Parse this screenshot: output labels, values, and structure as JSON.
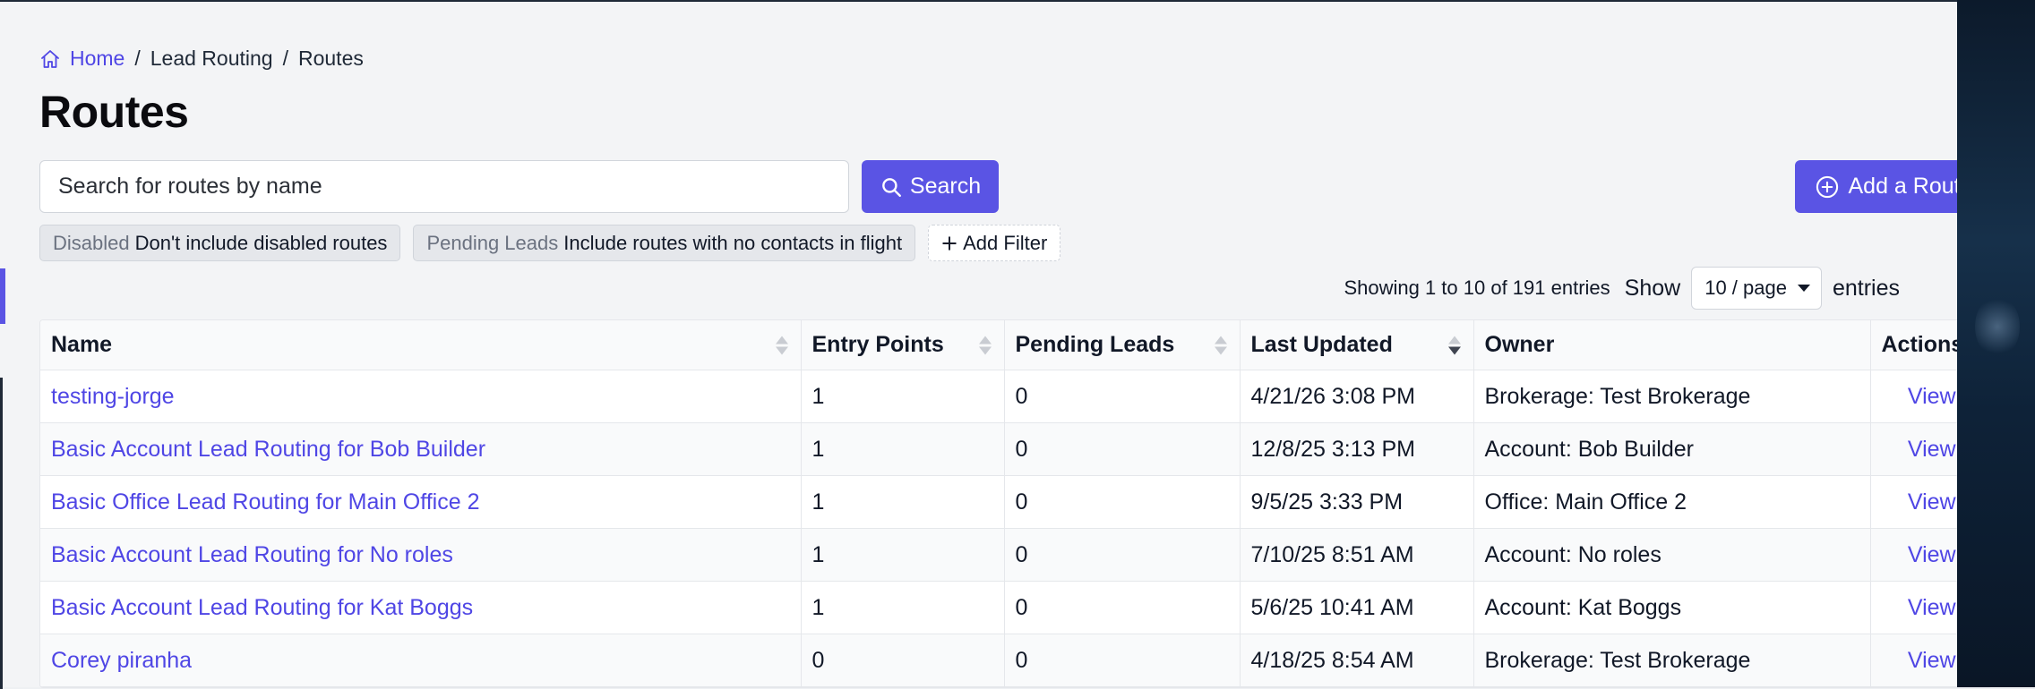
{
  "breadcrumb": {
    "home": "Home",
    "sep1": "/",
    "lead_routing": "Lead Routing",
    "sep2": "/",
    "current": "Routes"
  },
  "page": {
    "title": "Routes"
  },
  "search": {
    "placeholder": "Search for routes by name",
    "button_label": "Search"
  },
  "add_route": {
    "label": "Add a Route"
  },
  "filters": [
    {
      "key": "Disabled",
      "value": "Don't include disabled routes"
    },
    {
      "key": "Pending Leads",
      "value": "Include routes with no contacts in flight"
    }
  ],
  "add_filter": {
    "label": "Add Filter"
  },
  "pagination": {
    "summary": "Showing 1 to 10 of 191 entries",
    "show_label": "Show",
    "page_size": "10 / page",
    "entries_label": "entries"
  },
  "table": {
    "columns": {
      "name": "Name",
      "entry_points": "Entry Points",
      "pending_leads": "Pending Leads",
      "last_updated": "Last Updated",
      "owner": "Owner",
      "actions": "Actions"
    },
    "rows": [
      {
        "name": "testing-jorge",
        "entry_points": "1",
        "pending_leads": "0",
        "last_updated": "4/21/26 3:08 PM",
        "owner": "Brokerage: Test Brokerage",
        "action": "View"
      },
      {
        "name": "Basic Account Lead Routing for Bob Builder",
        "entry_points": "1",
        "pending_leads": "0",
        "last_updated": "12/8/25 3:13 PM",
        "owner": "Account: Bob Builder",
        "action": "View"
      },
      {
        "name": "Basic Office Lead Routing for Main Office 2",
        "entry_points": "1",
        "pending_leads": "0",
        "last_updated": "9/5/25 3:33 PM",
        "owner": "Office: Main Office 2",
        "action": "View"
      },
      {
        "name": "Basic Account Lead Routing for No roles",
        "entry_points": "1",
        "pending_leads": "0",
        "last_updated": "7/10/25 8:51 AM",
        "owner": "Account: No roles",
        "action": "View"
      },
      {
        "name": "Basic Account Lead Routing for Kat Boggs",
        "entry_points": "1",
        "pending_leads": "0",
        "last_updated": "5/6/25 10:41 AM",
        "owner": "Account: Kat Boggs",
        "action": "View"
      },
      {
        "name": "Corey piranha",
        "entry_points": "0",
        "pending_leads": "0",
        "last_updated": "4/18/25 8:54 AM",
        "owner": "Brokerage: Test Brokerage",
        "action": "View"
      }
    ]
  },
  "colors": {
    "accent": "#5a54e4",
    "link": "#4f46e5",
    "background": "#f3f4f6"
  },
  "icons": {
    "breadcrumb_home": "home-icon",
    "search_button": "search-icon",
    "add_route": "plus-circle-icon",
    "add_filter": "plus-icon",
    "sort": "sort-arrows-icon",
    "select": "caret-down-icon"
  }
}
